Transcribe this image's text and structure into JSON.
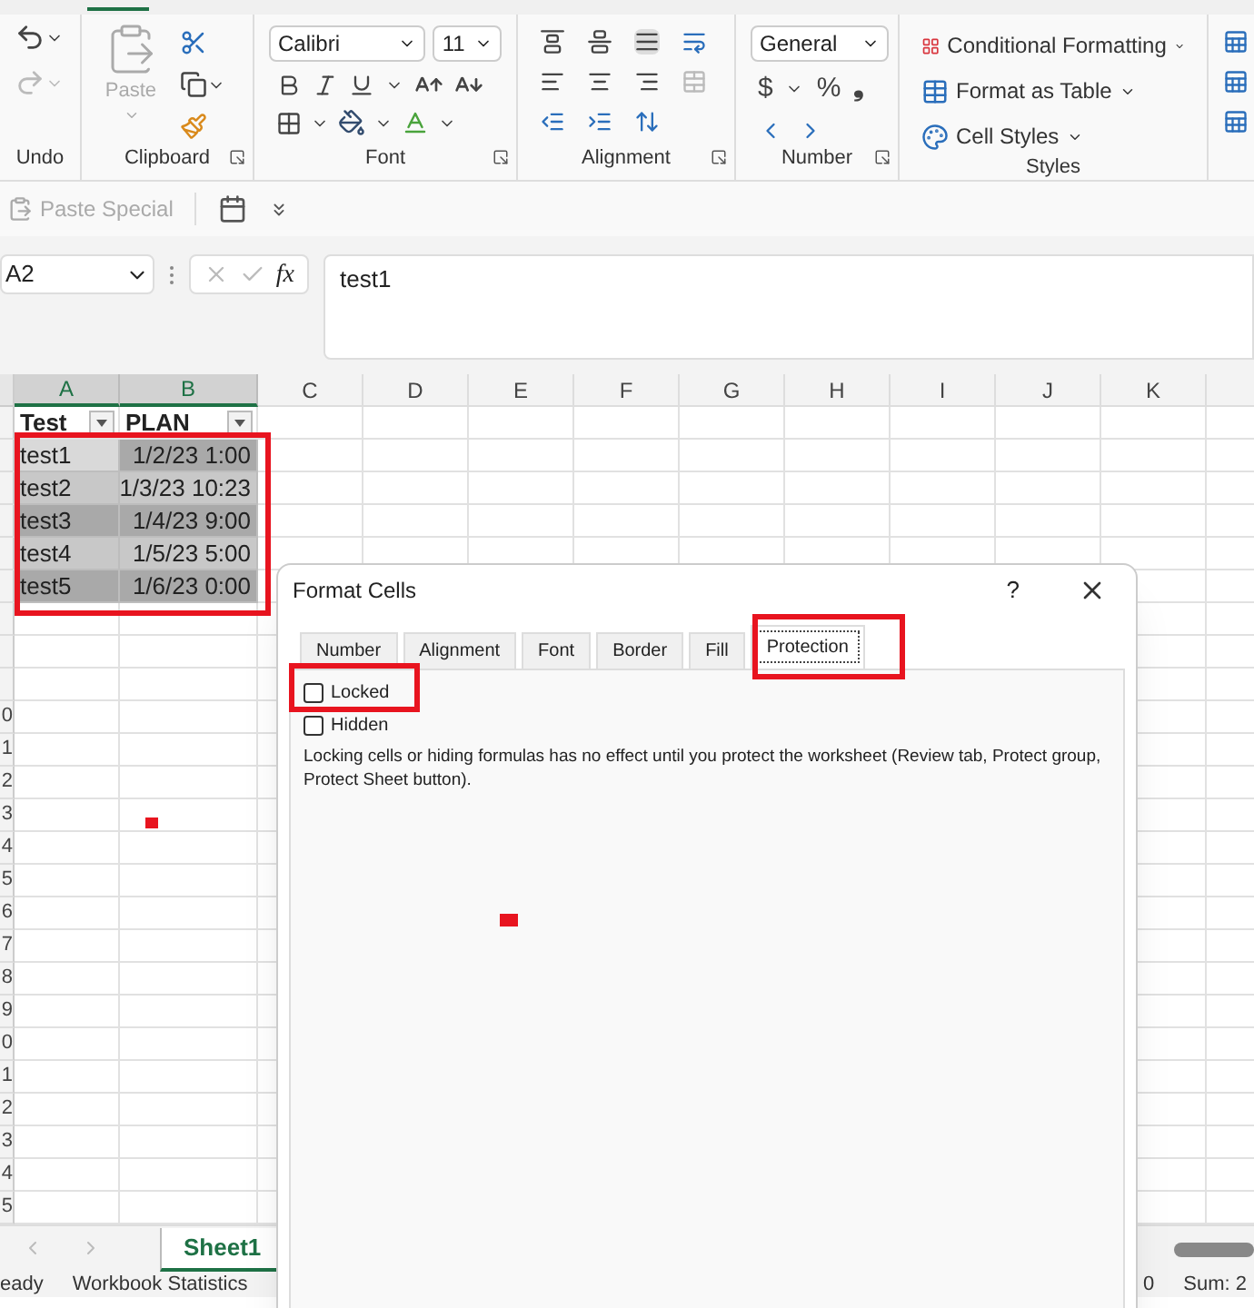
{
  "ribbon": {
    "groups": [
      {
        "kind": "undo",
        "label": "Undo"
      },
      {
        "kind": "clipboard",
        "label": "Clipboard",
        "paste_label": "Paste"
      },
      {
        "kind": "font",
        "label": "Font",
        "font_name": "Calibri",
        "font_size": "11"
      },
      {
        "kind": "alignment",
        "label": "Alignment"
      },
      {
        "kind": "number",
        "label": "Number",
        "format": "General",
        "currency": "$",
        "percent": "%",
        "comma": "❟"
      },
      {
        "kind": "styles",
        "label": "Styles",
        "buttons": [
          "Conditional Formatting",
          "Format as Table",
          "Cell Styles"
        ]
      }
    ]
  },
  "quick_access": {
    "paste_special": {
      "label": "Paste Special",
      "disabled": true
    }
  },
  "formula_bar": {
    "name_box": "A2",
    "function_label": "fx",
    "value": "test1"
  },
  "sheet": {
    "columns": [
      {
        "label": "A",
        "selected": true
      },
      {
        "label": "B",
        "selected": true
      },
      {
        "label": "C",
        "selected": false
      },
      {
        "label": "D",
        "selected": false
      },
      {
        "label": "E",
        "selected": false
      },
      {
        "label": "F",
        "selected": false
      },
      {
        "label": "G",
        "selected": false
      },
      {
        "label": "H",
        "selected": false
      },
      {
        "label": "I",
        "selected": false
      },
      {
        "label": "J",
        "selected": false
      },
      {
        "label": "K",
        "selected": false
      }
    ],
    "rows": [
      {
        "cells": [
          {
            "text": "Test",
            "kind": "header"
          },
          {
            "text": "PLAN",
            "kind": "header"
          }
        ]
      },
      {
        "cells": [
          {
            "text": "test1",
            "kind": "text",
            "active": true
          },
          {
            "text": "1/2/23 1:00",
            "kind": "date",
            "active": false
          }
        ]
      },
      {
        "cells": [
          {
            "text": "test2",
            "kind": "text",
            "active": false
          },
          {
            "text": "1/3/23 10:23",
            "kind": "date",
            "active": false
          }
        ]
      },
      {
        "cells": [
          {
            "text": "test3",
            "kind": "text",
            "active": false
          },
          {
            "text": "1/4/23 9:00",
            "kind": "date",
            "active": false
          }
        ]
      },
      {
        "cells": [
          {
            "text": "test4",
            "kind": "text",
            "active": false
          },
          {
            "text": "1/5/23 5:00",
            "kind": "date",
            "active": false
          }
        ]
      },
      {
        "cells": [
          {
            "text": "test5",
            "kind": "text",
            "active": false
          },
          {
            "text": "1/6/23 0:00",
            "kind": "date",
            "active": false
          }
        ]
      },
      {},
      {},
      {},
      {
        "header": "0"
      },
      {
        "header": "1"
      },
      {
        "header": "2"
      },
      {
        "header": "3"
      },
      {
        "header": "4"
      },
      {
        "header": "5"
      },
      {
        "header": "6"
      },
      {
        "header": "7"
      },
      {
        "header": "8"
      },
      {
        "header": "9"
      },
      {
        "header": "0"
      },
      {
        "header": "1"
      },
      {
        "header": "2"
      },
      {
        "header": "3"
      },
      {
        "header": "4"
      },
      {
        "header": "5"
      }
    ]
  },
  "sheet_tabs": [
    {
      "label": "Sheet1",
      "selected": true
    }
  ],
  "status_bar": {
    "mode": "eady",
    "workbook_statistics": "Workbook Statistics",
    "count": "0",
    "sum": "Sum: 2"
  },
  "dialog": {
    "title": "Format Cells",
    "help": "?",
    "tabs": [
      {
        "label": "Number",
        "selected": false
      },
      {
        "label": "Alignment",
        "selected": false
      },
      {
        "label": "Font",
        "selected": false
      },
      {
        "label": "Border",
        "selected": false
      },
      {
        "label": "Fill",
        "selected": false
      },
      {
        "label": "Protection",
        "selected": true
      }
    ],
    "checkboxes": [
      {
        "label": "Locked",
        "checked": false
      },
      {
        "label": "Hidden",
        "checked": false
      }
    ],
    "note": "Locking cells or hiding formulas has no effect until you protect the worksheet (Review tab, Protect group, Protect Sheet button)."
  }
}
